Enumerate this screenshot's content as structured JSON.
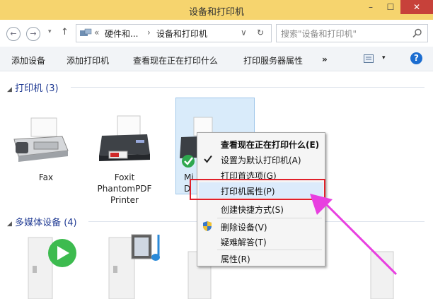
{
  "window": {
    "title": "设备和打印机",
    "minimize": "–",
    "maximize": "☐",
    "close": "✕"
  },
  "address": {
    "back": "←",
    "forward": "→",
    "up": "↑",
    "crumb_sep1": "«",
    "crumb1": "硬件和...",
    "crumb_sep2": "›",
    "crumb2": "设备和打印机",
    "dropdown": "∨",
    "refresh": "↻",
    "search_placeholder": "搜索\"设备和打印机\""
  },
  "toolbar": {
    "items": [
      "添加设备",
      "添加打印机",
      "查看现在正在打印什么",
      "打印服务器属性"
    ],
    "more": "»",
    "help": "?"
  },
  "groups": [
    {
      "label": "打印机 (3)"
    },
    {
      "label": "多媒体设备 (4)"
    }
  ],
  "printers": [
    {
      "name": "Fax"
    },
    {
      "name": "Foxit\nPhantomPDF\nPrinter"
    },
    {
      "name": "Mi\nD"
    }
  ],
  "context_menu": {
    "items": [
      {
        "label": "查看现在正在打印什么(E)",
        "bold": true
      },
      {
        "label": "设置为默认打印机(A)",
        "checked": true
      },
      {
        "label": "打印首选项(G)"
      },
      {
        "label": "打印机属性(P)",
        "highlighted": true
      },
      {
        "label": "创建快捷方式(S)"
      },
      {
        "label": "删除设备(V)",
        "shield": true
      },
      {
        "label": "疑难解答(T)"
      },
      {
        "label": "属性(R)"
      }
    ]
  },
  "colors": {
    "titlebar": "#f6d46e",
    "highlight_border": "#e0202a",
    "arrow": "#e83fe0",
    "group_text": "#1f3a93"
  }
}
